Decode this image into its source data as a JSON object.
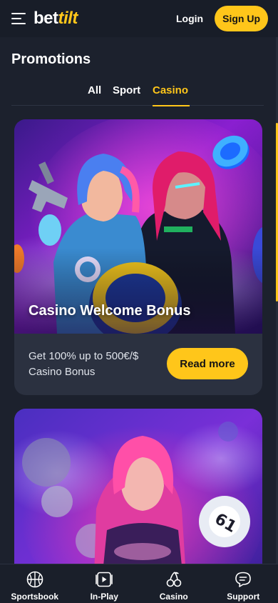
{
  "header": {
    "logo_part1": "bet",
    "logo_part2": "tilt",
    "login_label": "Login",
    "signup_label": "Sign Up"
  },
  "page": {
    "title": "Promotions"
  },
  "tabs": [
    {
      "label": "All",
      "active": false
    },
    {
      "label": "Sport",
      "active": false
    },
    {
      "label": "Casino",
      "active": true
    }
  ],
  "promotions": [
    {
      "title": "Casino Welcome Bonus",
      "description": "Get 100% up to 500€/$ Casino Bonus",
      "button_label": "Read more"
    },
    {
      "title": "",
      "description": "",
      "button_label": ""
    }
  ],
  "bottom_nav": [
    {
      "label": "Sportsbook",
      "icon": "basketball-icon"
    },
    {
      "label": "In-Play",
      "icon": "play-icon"
    },
    {
      "label": "Casino",
      "icon": "cherries-icon"
    },
    {
      "label": "Support",
      "icon": "chat-icon"
    }
  ],
  "colors": {
    "accent": "#ffc61a",
    "background": "#1c212d",
    "card": "#2b3140"
  }
}
